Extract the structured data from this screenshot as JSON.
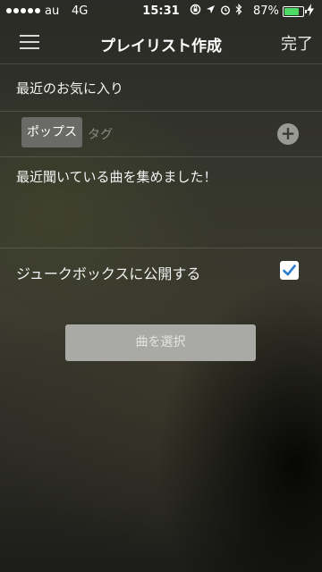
{
  "status_bar": {
    "carrier": "au",
    "network": "4G",
    "time": "15:31",
    "battery_percent": "87%",
    "battery_level": 0.87,
    "icons": [
      "rotation-lock-icon",
      "location-icon",
      "alarm-icon",
      "bluetooth-icon",
      "charging-icon"
    ]
  },
  "nav": {
    "menu_icon": "hamburger-menu-icon",
    "title": "プレイリスト作成",
    "done_label": "完了"
  },
  "playlist": {
    "name": "最近のお気に入り"
  },
  "tags": {
    "chips": [
      "ポップス"
    ],
    "input_placeholder": "タグ",
    "add_icon": "plus-circle-icon"
  },
  "description": "最近聞いている曲を集めました！",
  "jukebox": {
    "label": "ジュークボックスに公開する",
    "checked": true
  },
  "select_songs_label": "曲を選択",
  "colors": {
    "battery_fill": "#4cd964",
    "checkmark": "#2f7fd0",
    "button_bg": "#a9a9a6"
  }
}
